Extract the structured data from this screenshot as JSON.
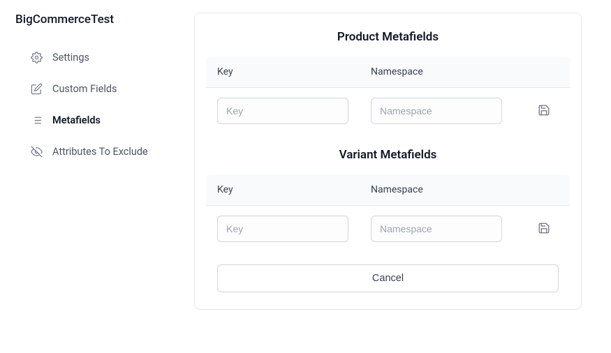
{
  "app_title": "BigCommerceTest",
  "sidebar": {
    "items": [
      {
        "label": "Settings",
        "icon": "gear-icon",
        "active": false
      },
      {
        "label": "Custom Fields",
        "icon": "edit-icon",
        "active": false
      },
      {
        "label": "Metafields",
        "icon": "list-icon",
        "active": true
      },
      {
        "label": "Attributes To Exclude",
        "icon": "eye-off-icon",
        "active": false
      }
    ]
  },
  "main": {
    "sections": [
      {
        "title": "Product Metafields",
        "columns": {
          "key_label": "Key",
          "namespace_label": "Namespace"
        },
        "row": {
          "key_value": "",
          "key_placeholder": "Key",
          "namespace_value": "",
          "namespace_placeholder": "Namespace"
        }
      },
      {
        "title": "Variant Metafields",
        "columns": {
          "key_label": "Key",
          "namespace_label": "Namespace"
        },
        "row": {
          "key_value": "",
          "key_placeholder": "Key",
          "namespace_value": "",
          "namespace_placeholder": "Namespace"
        }
      }
    ],
    "cancel_label": "Cancel"
  }
}
